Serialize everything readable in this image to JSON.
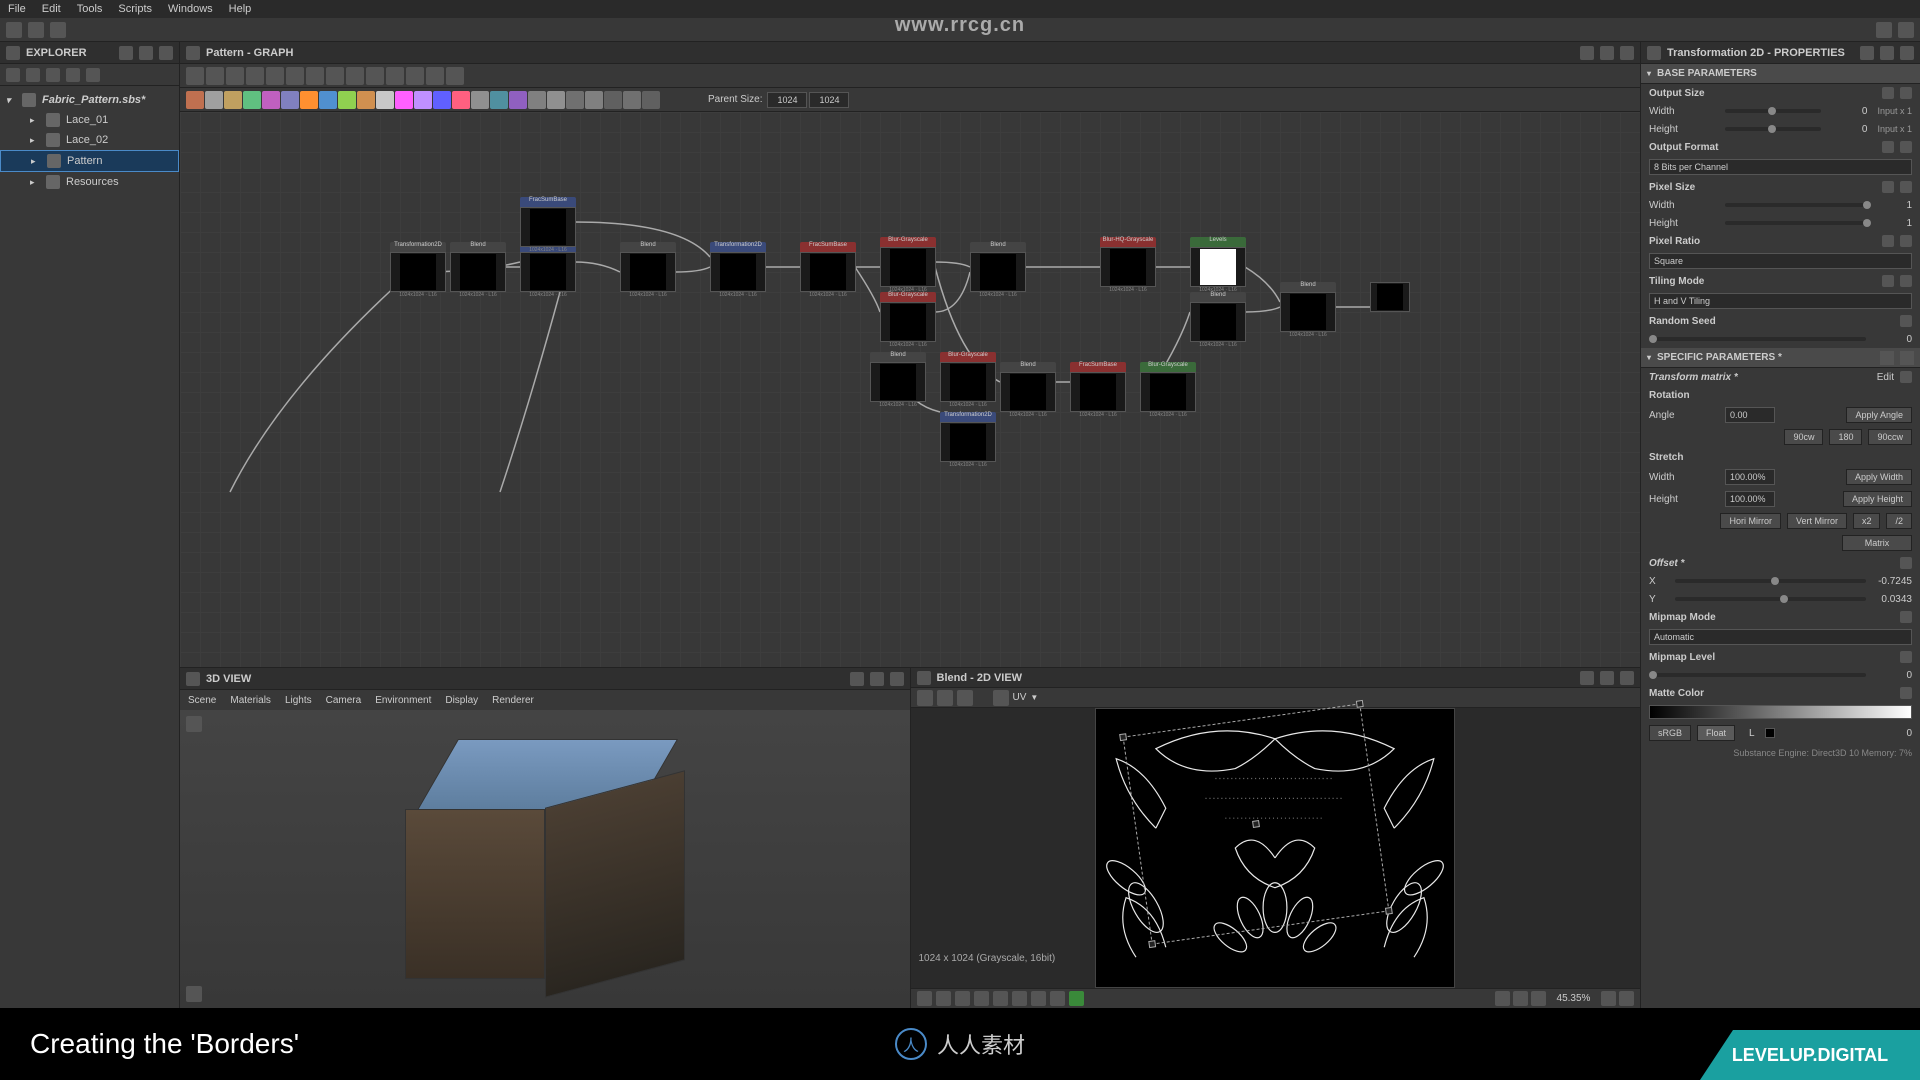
{
  "menubar": [
    "File",
    "Edit",
    "Tools",
    "Scripts",
    "Windows",
    "Help"
  ],
  "watermark": "www.rrcg.cn",
  "explorer": {
    "title": "EXPLORER",
    "root": "Fabric_Pattern.sbs*",
    "items": [
      "Lace_01",
      "Lace_02",
      "Pattern",
      "Resources"
    ],
    "selected": "Pattern"
  },
  "graph": {
    "title": "Pattern - GRAPH",
    "parentSizeLabel": "Parent Size:",
    "parentW": "1024",
    "parentH": "1024"
  },
  "view3d": {
    "title": "3D VIEW",
    "menu": [
      "Scene",
      "Materials",
      "Lights",
      "Camera",
      "Environment",
      "Display",
      "Renderer"
    ]
  },
  "view2d": {
    "title": "Blend - 2D VIEW",
    "uvLabel": "UV",
    "status": "1024 x 1024 (Grayscale, 16bit)",
    "zoom": "45.35%"
  },
  "props": {
    "title": "Transformation 2D - PROPERTIES",
    "baseParams": "BASE PARAMETERS",
    "specificParams": "SPECIFIC PARAMETERS *",
    "outputSize": "Output Size",
    "width": "Width",
    "height": "Height",
    "outputSizeVal": "0",
    "inputX1": "Input x 1",
    "outputFormat": "Output Format",
    "outputFormatVal": "8 Bits per Channel",
    "pixelSize": "Pixel Size",
    "pixelSizeVal": "1",
    "pixelRatio": "Pixel Ratio",
    "pixelRatioVal": "Square",
    "tilingMode": "Tiling Mode",
    "tilingModeVal": "H and V Tiling",
    "randomSeed": "Random Seed",
    "randomSeedVal": "0",
    "transformMatrix": "Transform matrix *",
    "edit": "Edit",
    "rotation": "Rotation",
    "angle": "Angle",
    "angleVal": "0.00",
    "applyAngle": "Apply Angle",
    "rot90cw": "90cw",
    "rot180": "180",
    "rot90ccw": "90ccw",
    "stretch": "Stretch",
    "stretchW": "100.00%",
    "stretchH": "100.00%",
    "applyWidth": "Apply Width",
    "applyHeight": "Apply Height",
    "horiMirror": "Hori Mirror",
    "vertMirror": "Vert Mirror",
    "x2": "x2",
    "div2": "/2",
    "matrix": "Matrix",
    "offset": "Offset *",
    "x": "X",
    "y": "Y",
    "xVal": "-0.7245",
    "yVal": "0.0343",
    "mipmapMode": "Mipmap Mode",
    "mipmapModeVal": "Automatic",
    "mipmapLevel": "Mipmap Level",
    "mipmapLevelVal": "0",
    "matteColor": "Matte Color",
    "srgb": "sRGB",
    "float": "Float",
    "lLabel": "L",
    "lVal": "0",
    "statusLine": "Substance Engine: Direct3D 10  Memory: 7%"
  },
  "footer": {
    "title": "Creating the 'Borders'",
    "logoText": "人人素材",
    "brand": "LEVELUP.DIGITAL"
  },
  "swatches": [
    "#c07050",
    "#a0a0a0",
    "#c0a060",
    "#60c080",
    "#c060c0",
    "#8080c0",
    "#ff9030",
    "#5090d0",
    "#90d050",
    "#d09050",
    "#c8c8c8",
    "#ff60ff",
    "#c090ff",
    "#6060ff",
    "#ff6080",
    "#909090",
    "#5090a0",
    "#9060c0",
    "#808080",
    "#909090",
    "#707070",
    "#808080",
    "#606060",
    "#707070",
    "#606060"
  ]
}
